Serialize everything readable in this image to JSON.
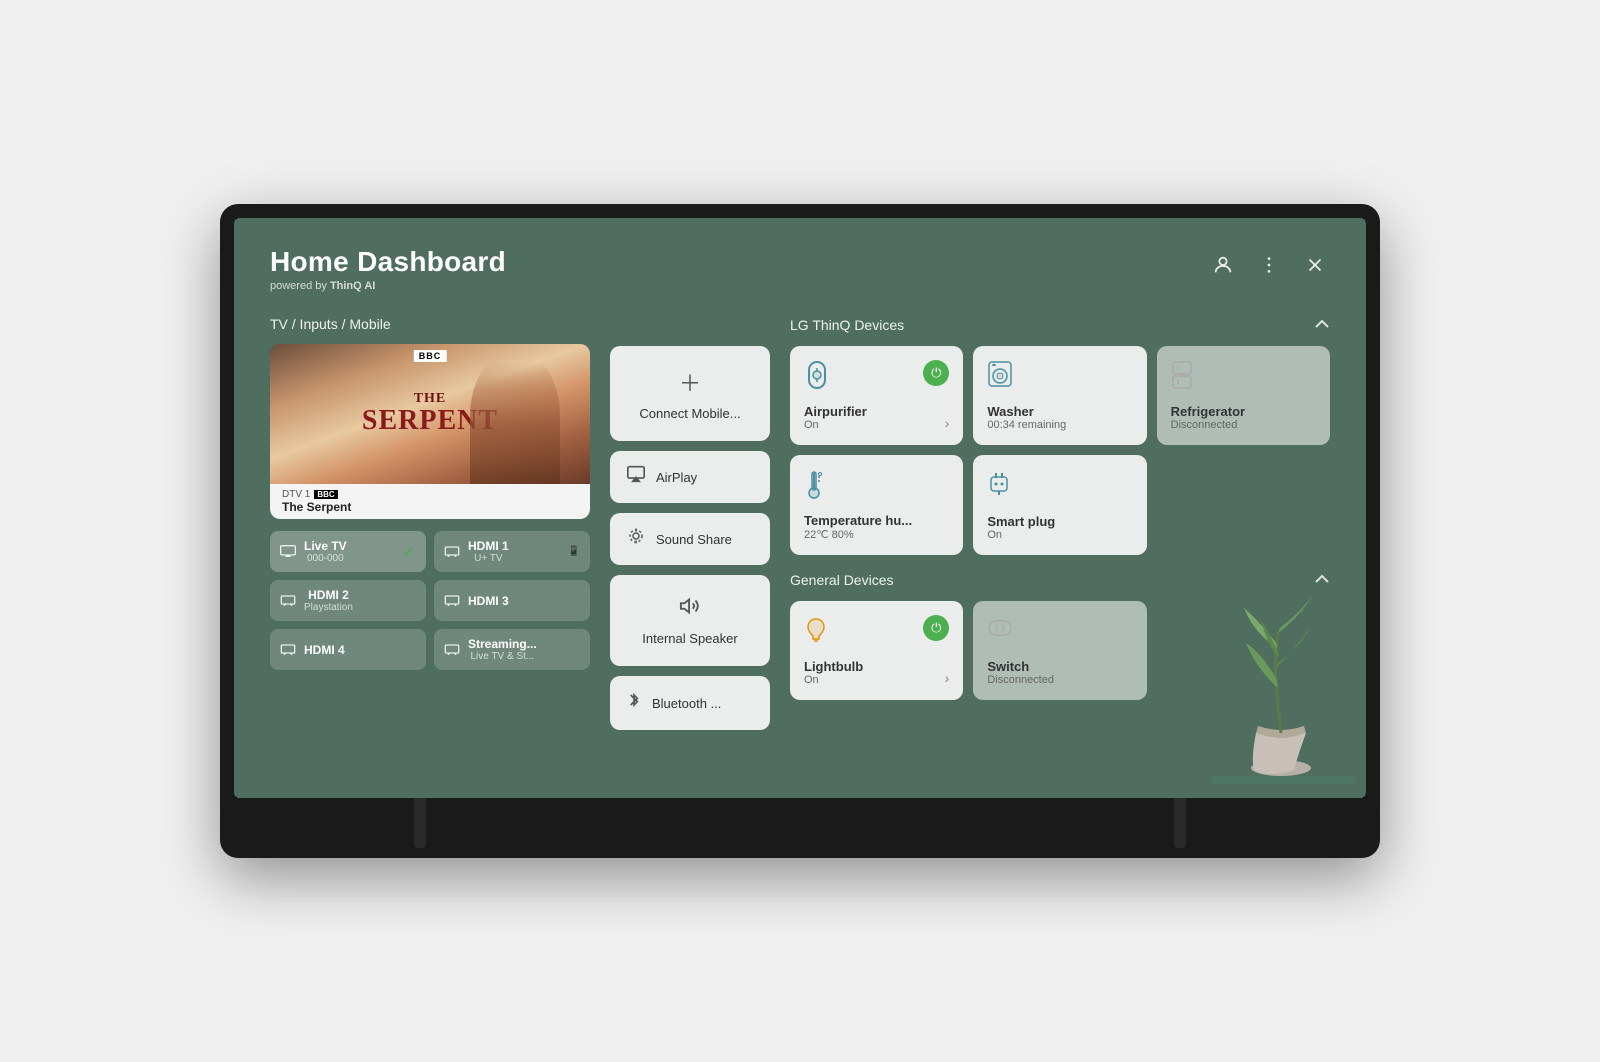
{
  "tv": {
    "title": "Home Dashboard",
    "subtitle_powered": "powered by",
    "subtitle_brand": "ThinQ AI"
  },
  "header": {
    "title": "Home Dashboard",
    "subtitle": "powered by ThinQ AI",
    "icons": {
      "profile": "👤",
      "menu": "⋮",
      "close": "✕"
    }
  },
  "tv_inputs": {
    "section_label": "TV / Inputs / Mobile",
    "preview": {
      "channel": "DTV 1",
      "channel_badge": "BBC",
      "show": "The Serpent",
      "show_title_line1": "THE",
      "show_title_line2": "SERPENT"
    },
    "inputs": [
      {
        "id": "live-tv",
        "name": "Live TV",
        "sub": "000-000",
        "active": true,
        "icon": "📺"
      },
      {
        "id": "hdmi1",
        "name": "HDMI 1",
        "sub": "U+ TV",
        "active": false,
        "icon": "⬛"
      },
      {
        "id": "hdmi2",
        "name": "HDMI 2",
        "sub": "Playstation",
        "active": false,
        "icon": "⬛"
      },
      {
        "id": "hdmi3",
        "name": "HDMI 3",
        "sub": "",
        "active": false,
        "icon": "⬛"
      },
      {
        "id": "hdmi4",
        "name": "HDMI 4",
        "sub": "",
        "active": false,
        "icon": "⬛"
      },
      {
        "id": "streaming",
        "name": "Streaming...",
        "sub": "Live TV & St...",
        "active": false,
        "icon": "⬛"
      }
    ]
  },
  "mobile_section": {
    "connect_label": "Connect Mobile...",
    "airplay_label": "AirPlay",
    "sound_share_label": "Sound Share",
    "internal_speaker_label": "Internal Speaker",
    "bluetooth_label": "Bluetooth ..."
  },
  "thinq_devices": {
    "section_label": "LG ThinQ Devices",
    "devices": [
      {
        "id": "airpurifier",
        "name": "Airpurifier",
        "status": "On",
        "power": "on",
        "disconnected": false,
        "icon": "🌀"
      },
      {
        "id": "washer",
        "name": "Washer",
        "status": "00:34 remaining",
        "power": "on",
        "disconnected": false,
        "icon": "🫧"
      },
      {
        "id": "refrigerator",
        "name": "Refrigerator",
        "status": "Disconnected",
        "power": "off",
        "disconnected": true,
        "icon": "🧊"
      },
      {
        "id": "temperature",
        "name": "Temperature hu...",
        "status": "22℃ 80%",
        "power": "on",
        "disconnected": false,
        "icon": "🌡"
      },
      {
        "id": "smartplug",
        "name": "Smart plug",
        "status": "On",
        "power": "on",
        "disconnected": false,
        "icon": "🔌"
      }
    ]
  },
  "general_devices": {
    "section_label": "General Devices",
    "devices": [
      {
        "id": "lightbulb",
        "name": "Lightbulb",
        "status": "On",
        "power": "on",
        "disconnected": false,
        "icon": "💡"
      },
      {
        "id": "switch",
        "name": "Switch",
        "status": "Disconnected",
        "power": "off",
        "disconnected": true,
        "icon": "🔘"
      }
    ]
  }
}
